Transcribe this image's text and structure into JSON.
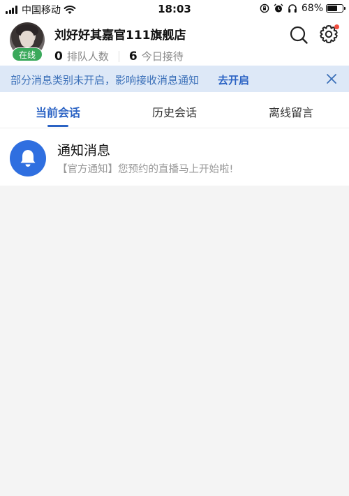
{
  "status_bar": {
    "carrier": "中国移动",
    "time": "18:03",
    "battery_percent": "68%",
    "battery_level": 0.68
  },
  "header": {
    "store_name": "刘好好其嘉官111旗舰店",
    "online_status": "在线",
    "queue_count": "0",
    "queue_label": "排队人数",
    "today_count": "6",
    "today_label": "今日接待",
    "search_icon": "search-icon",
    "settings_icon": "gear-icon",
    "settings_has_badge": true,
    "colors": {
      "online": "#3aa95b",
      "badge": "#f04d3f"
    }
  },
  "notice": {
    "text": "部分消息类别未开启，影响接收消息通知",
    "action": "去开启",
    "close_icon": "close-icon",
    "colors": {
      "background": "#dde8f7",
      "text": "#3a6fb8"
    }
  },
  "tabs": [
    {
      "label": "当前会话",
      "active": true
    },
    {
      "label": "历史会话",
      "active": false
    },
    {
      "label": "离线留言",
      "active": false
    }
  ],
  "accent_color": "#2b63c4",
  "conversations": [
    {
      "title": "通知消息",
      "preview": "【官方通知】您预约的直播马上开始啦!",
      "icon": "bell-icon",
      "icon_color": "#2f6fe0"
    }
  ]
}
